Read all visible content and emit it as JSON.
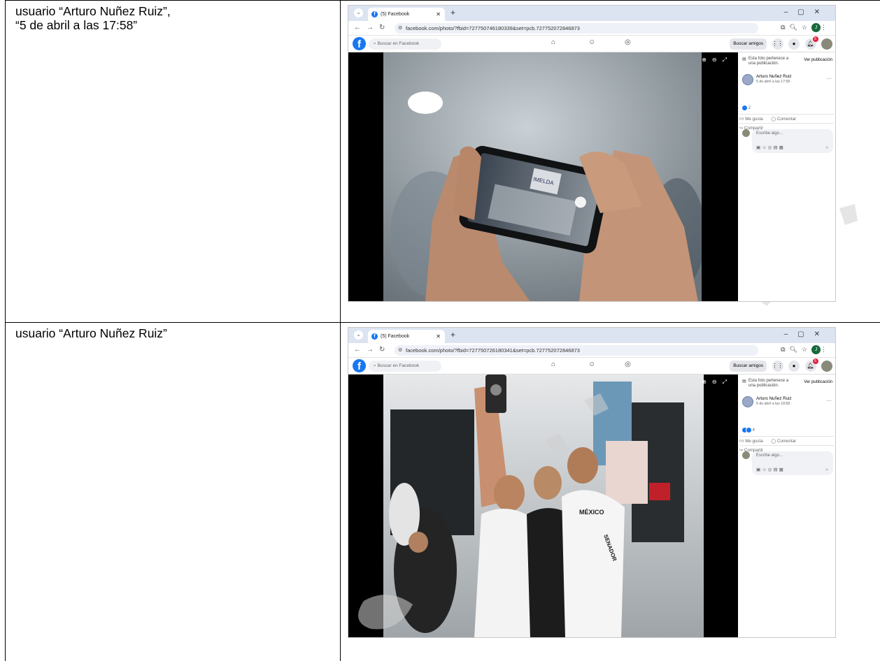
{
  "rows": [
    {
      "caption_line1": "usuario “Arturo Nuñez Ruiz”,",
      "caption_line2": "“5 de abril a las 17:58”",
      "browser": {
        "tab_title": "(5) Facebook",
        "url": "facebook.com/photo/?fbid=727750746180339&set=pcb.727752072846873",
        "profile_letter": "J"
      },
      "facebook": {
        "search_placeholder": "Buscar en Facebook",
        "buscar_amigos": "Buscar amigos",
        "notif_count": "5",
        "belongs_to": "Esta foto pertenece a una publicación.",
        "ver_publicacion": "Ver publicación",
        "author": "Arturo Nuñez Ruiz",
        "post_date": "5 de abril a las 17:58 ·",
        "reaction_count": "2",
        "like": "Me gusta",
        "comment": "Comentar",
        "share": "Compartir",
        "write_placeholder": "Escribe algo..."
      },
      "photo_text": "IMELDA"
    },
    {
      "caption_line1": "usuario “Arturo Nuñez Ruiz”",
      "caption_line2": "",
      "browser": {
        "tab_title": "(5) Facebook",
        "url": "facebook.com/photo/?fbid=727750726180341&set=pcb.727752072846873",
        "profile_letter": "J"
      },
      "facebook": {
        "search_placeholder": "Buscar en Facebook",
        "buscar_amigos": "Buscar amigos",
        "notif_count": "5",
        "belongs_to": "Esta foto pertenece a una publicación.",
        "ver_publicacion": "Ver publicación",
        "author": "Arturo Nuñez Ruiz",
        "post_date": "5 de abril a las 18:58 ·",
        "reaction_count": "4",
        "like": "Me gusta",
        "comment": "Comentar",
        "share": "Compartir",
        "write_placeholder": "Escribe algo..."
      },
      "photo_text": "MÉXICO",
      "photo_text2": "SENADOR"
    }
  ],
  "icons": {
    "fb_logo": "f",
    "home": "⌂",
    "friends": "☺",
    "groups": "◎"
  }
}
